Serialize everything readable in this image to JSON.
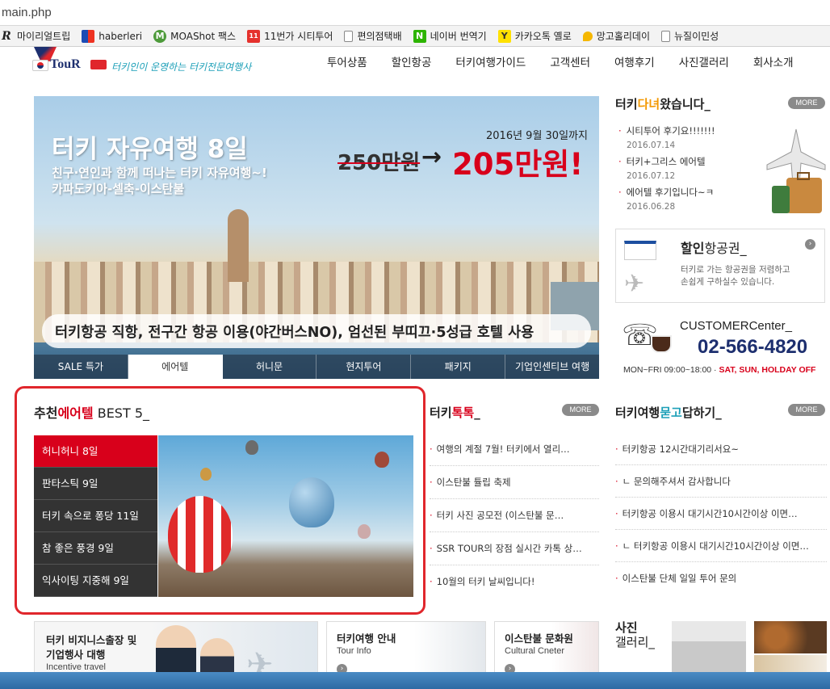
{
  "browser": {
    "address": "main.php",
    "bookmarks": [
      {
        "label": "마이리얼트립",
        "icon": "R"
      },
      {
        "label": "haberleri",
        "icon": "flag"
      },
      {
        "label": "MOAShot 팩스",
        "icon": "M"
      },
      {
        "label": "11번가 시티투어",
        "icon": "11"
      },
      {
        "label": "편의점택배",
        "icon": "page"
      },
      {
        "label": "네이버 번역기",
        "icon": "N"
      },
      {
        "label": "카카오톡 옐로",
        "icon": "Y"
      },
      {
        "label": "망고홀리데이",
        "icon": "mango"
      },
      {
        "label": "뉴질이민성",
        "icon": "page"
      }
    ]
  },
  "header": {
    "logo_text": "TouR",
    "logo_slogan": "터키인이 운영하는 터키전문여행사",
    "nav": [
      "투어상품",
      "할인항공",
      "터키여행가이드",
      "고객센터",
      "여행후기",
      "사진갤러리",
      "회사소개"
    ]
  },
  "banner": {
    "title": "터키 자유여행 8일",
    "sub1": "친구·연인과 함께 떠나는 터키 자유여행~!",
    "sub2": "카파도키아-셀축-이스탄불",
    "date": "2016년 9월 30일까지",
    "old_price": "250만원",
    "arrow": "→",
    "new_price": "205만원!",
    "caption": "터키항공 직항, 전구간 항공 이용(야간버스NO), 엄선된 부띠끄·5성급 호텔 사용",
    "tabs": [
      "SALE 특가",
      "에어텔",
      "허니문",
      "현지투어",
      "패키지",
      "기업인센티브 여행"
    ],
    "active_tab": 1
  },
  "reviews": {
    "title_a": "터키",
    "title_b": "다녀",
    "title_c": "왔습니다_",
    "more": "MORE",
    "items": [
      {
        "text": "시티투어 후기요!!!!!!!",
        "date": "2016.07.14"
      },
      {
        "text": "터키+그리스 에어텔",
        "date": "2016.07.12"
      },
      {
        "text": "에어텔 후기입니다~ㅋ",
        "date": "2016.06.28"
      }
    ]
  },
  "airticket": {
    "title_a": "할인",
    "title_b": "항공권_",
    "desc1": "터키로 가는 항공권을 저렴하고",
    "desc2": "손쉽게 구하실수 있습니다."
  },
  "customer": {
    "title_a": "CUSTOMER",
    "title_b": "Center_",
    "phone": "02-566-4820",
    "hours_a": "MON~FRI 09:00~18:00 ·",
    "hours_b": "SAT, SUN, HOLDAY OFF"
  },
  "recommend": {
    "title_a": "추천",
    "title_b": "에어텔",
    "title_c": " BEST 5_",
    "items": [
      "허니허니 8일",
      "판타스틱 9일",
      "터키 속으로 퐁당 11일",
      "참 좋은 풍경 9일",
      "익사이팅 지중해 9일"
    ],
    "active": 0
  },
  "talk": {
    "title_a": "터키",
    "title_b": "톡톡",
    "title_c": "_",
    "more": "MORE",
    "items": [
      "여행의 계절 7월! 터키에서 열리…",
      "이스탄불 튤립 축제",
      "터키 사진 공모전 (이스탄불 문…",
      "SSR TOUR의 장점 실시간 카톡 상…",
      "10월의 터키 날씨입니다!"
    ]
  },
  "qna": {
    "title_a": "터키여행",
    "title_b": "묻고",
    "title_c": "답하기_",
    "more": "MORE",
    "items": [
      "터키항공 12시간대기리서요~",
      "ㄴ 문의해주셔서 감사합니다",
      "터키항공 이용시 대기시간10시간이상 이면…",
      "ㄴ 터키항공 이용시 대기시간10시간이상 이면…",
      "이스탄불 단체 일일 투어 문의"
    ]
  },
  "bottom": {
    "biz_title1": "터키 비지니스출장 및",
    "biz_title2": "기업행사 대행",
    "biz_sub": "Incentive travel",
    "info_title": "터키여행 안내",
    "info_sub": "Tour Info",
    "culture_title": "이스탄불 문화원",
    "culture_sub": "Cultural Cneter",
    "gallery_title1": "사진",
    "gallery_title2": "갤러리_"
  },
  "colors": {
    "accent": "#d8001b",
    "orange": "#f39800",
    "teal": "#1ea0b8",
    "navy": "#1d2f6f"
  }
}
